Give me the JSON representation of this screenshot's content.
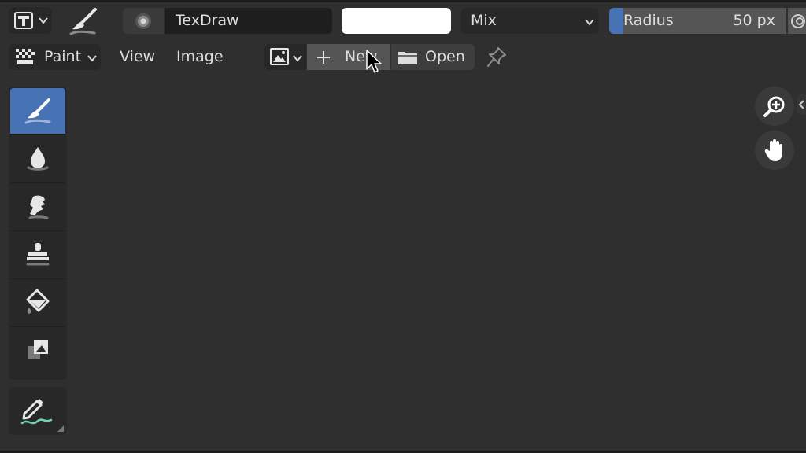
{
  "header": {
    "editor_type_icon": "image-editor-icon",
    "brush_icon": "brush-icon",
    "brush_name": "TexDraw",
    "color_swatch": "#ffffff",
    "blend_mode": "Mix",
    "radius_label": "Radius",
    "radius_value": "50 px",
    "radius_fill_fraction": 0.02,
    "accent": "#4772b3"
  },
  "menubar": {
    "mode_label": "Paint",
    "view_label": "View",
    "image_label": "Image",
    "new_label": "New",
    "open_label": "Open"
  },
  "tools": [
    {
      "name": "draw-tool",
      "icon": "brush-icon",
      "active": true
    },
    {
      "name": "soften-tool",
      "icon": "drop-icon",
      "active": false
    },
    {
      "name": "smear-tool",
      "icon": "smear-icon",
      "active": false
    },
    {
      "name": "clone-tool",
      "icon": "stamp-icon",
      "active": false
    },
    {
      "name": "fill-tool",
      "icon": "paint-bucket-icon",
      "active": false
    },
    {
      "name": "mask-tool",
      "icon": "mask-icon",
      "active": false
    }
  ],
  "annotate_tool": {
    "icon": "annotate-pencil-icon"
  },
  "navigation": {
    "zoom_icon": "zoom-icon",
    "pan_icon": "hand-icon"
  }
}
